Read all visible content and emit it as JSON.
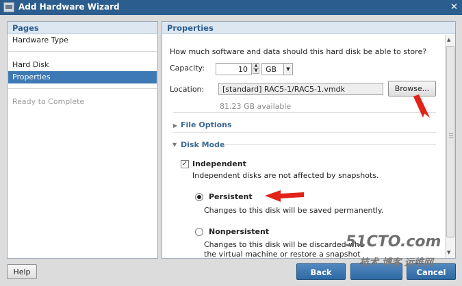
{
  "window": {
    "title": "Add Hardware Wizard",
    "close_glyph": "✕"
  },
  "pages": {
    "header": "Pages",
    "items": [
      "Hardware Type",
      "Hard Disk",
      "Properties",
      "Ready to Complete"
    ],
    "selected": "Properties"
  },
  "properties": {
    "header": "Properties",
    "question": "How much software and data should this hard disk be able to store?",
    "capacity_label": "Capacity:",
    "capacity_value": "10",
    "capacity_unit": "GB",
    "location_label": "Location:",
    "location_value": "[standard] RAC5-1/RAC5-1.vmdk",
    "browse_label": "Browse...",
    "available": "81.23 GB available",
    "file_options_label": "File Options",
    "disk_mode_label": "Disk Mode",
    "independent_label": "Independent",
    "independent_checked": true,
    "independent_desc": "Independent disks are not affected by snapshots.",
    "persistent_label": "Persistent",
    "persistent_desc": "Changes to this disk will be saved permanently.",
    "nonpersistent_label": "Nonpersistent",
    "nonpersistent_desc_1": "Changes to this disk will be discarded whe",
    "nonpersistent_desc_2": "the virtual machine or restore a snapshot",
    "selected_mode": "Persistent"
  },
  "footer": {
    "help_label": "Help",
    "back_label": "Back",
    "cancel_label": "Cancel"
  },
  "watermark": {
    "line1": "51CTO.com",
    "line2": "技术 博客 运维网"
  },
  "colors": {
    "title_bar": "#2b5d8e",
    "selection": "#3d79b4",
    "arrow": "#e2231a",
    "header_text": "#2b5d8e"
  },
  "icons": {
    "close": "close-icon",
    "checkbox": "checkmark-icon"
  }
}
